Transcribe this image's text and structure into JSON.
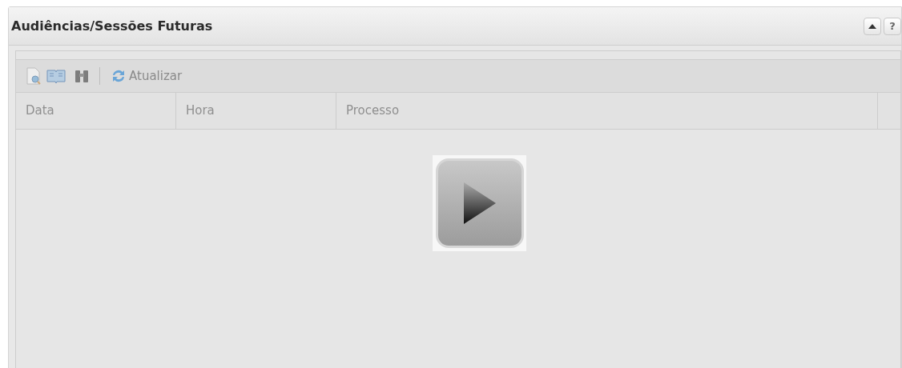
{
  "panel": {
    "title": "Audiências/Sessões Futuras",
    "help_label": "?"
  },
  "toolbar": {
    "refresh_label": "Atualizar"
  },
  "table": {
    "columns": [
      "Data",
      "Hora",
      "Processo"
    ]
  }
}
